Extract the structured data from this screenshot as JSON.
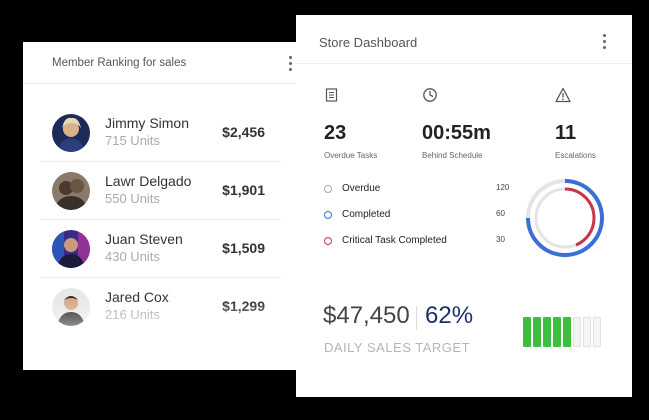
{
  "ranking": {
    "title": "Member Ranking for sales",
    "rows": [
      {
        "name": "Jimmy Simon",
        "units": "715 Units",
        "amount": "$2,456"
      },
      {
        "name": "Lawr Delgado",
        "units": "550 Units",
        "amount": "$1,901"
      },
      {
        "name": "Juan Steven",
        "units": "430 Units",
        "amount": "$1,509"
      },
      {
        "name": "Jared Cox",
        "units": "216 Units",
        "amount": "$1,299"
      }
    ]
  },
  "store": {
    "title": "Store Dashboard",
    "stats": [
      {
        "icon": "clipboard-icon",
        "value": "23",
        "label": "Overdue Tasks"
      },
      {
        "icon": "clock-icon",
        "value": "00:55m",
        "label": "Behind Schedule"
      },
      {
        "icon": "warning-icon",
        "value": "11",
        "label": "Escalations"
      }
    ],
    "legend": [
      {
        "label": "Overdue",
        "count": "120",
        "color": "#aaaaaa"
      },
      {
        "label": "Completed",
        "count": "60",
        "color": "#3a6fd8"
      },
      {
        "label": "Critical Task Completed",
        "count": "30",
        "color": "#c8364a"
      }
    ],
    "sales": {
      "amount": "$47,450",
      "percent": "62%",
      "label": "DAILY SALES TARGET",
      "progress": 0.62
    }
  },
  "colors": {
    "accent_blue": "#3a6fd8",
    "accent_red": "#c8364a",
    "battery_green": "#3cbf3c",
    "navy": "#1f2f6b"
  }
}
